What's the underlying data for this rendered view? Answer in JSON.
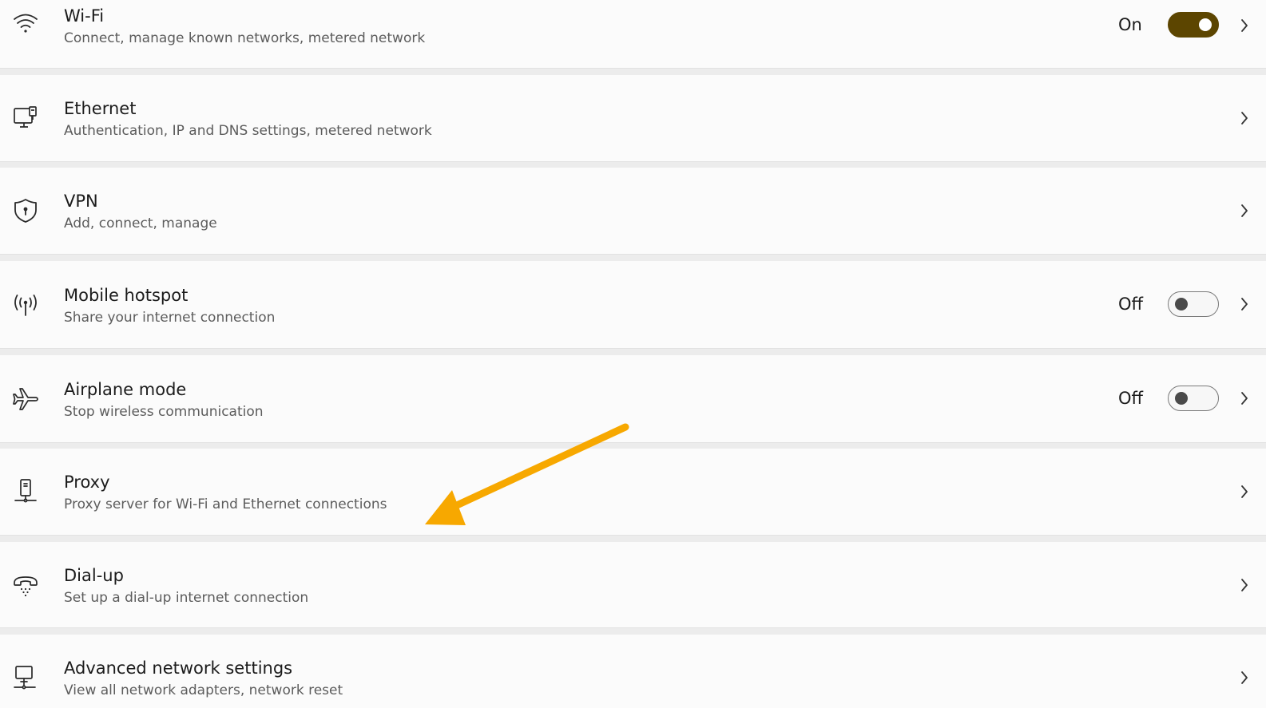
{
  "settings": {
    "items": [
      {
        "id": "wifi",
        "icon": "wifi-icon",
        "title": "Wi-Fi",
        "subtitle": "Connect, manage known networks, metered network",
        "toggle": {
          "label": "On",
          "state": "on"
        }
      },
      {
        "id": "ethernet",
        "icon": "ethernet-icon",
        "title": "Ethernet",
        "subtitle": "Authentication, IP and DNS settings, metered network"
      },
      {
        "id": "vpn",
        "icon": "vpn-shield-icon",
        "title": "VPN",
        "subtitle": "Add, connect, manage"
      },
      {
        "id": "mobile-hotspot",
        "icon": "hotspot-icon",
        "title": "Mobile hotspot",
        "subtitle": "Share your internet connection",
        "toggle": {
          "label": "Off",
          "state": "off"
        }
      },
      {
        "id": "airplane-mode",
        "icon": "airplane-icon",
        "title": "Airplane mode",
        "subtitle": "Stop wireless communication",
        "toggle": {
          "label": "Off",
          "state": "off"
        }
      },
      {
        "id": "proxy",
        "icon": "proxy-icon",
        "title": "Proxy",
        "subtitle": "Proxy server for Wi-Fi and Ethernet connections"
      },
      {
        "id": "dial-up",
        "icon": "dialup-phone-icon",
        "title": "Dial-up",
        "subtitle": "Set up a dial-up internet connection"
      },
      {
        "id": "advanced-network-settings",
        "icon": "network-adapter-icon",
        "title": "Advanced network settings",
        "subtitle": "View all network adapters, network reset"
      }
    ]
  },
  "colors": {
    "toggle_on": "#5c4500",
    "annotation_arrow": "#f7a800"
  }
}
